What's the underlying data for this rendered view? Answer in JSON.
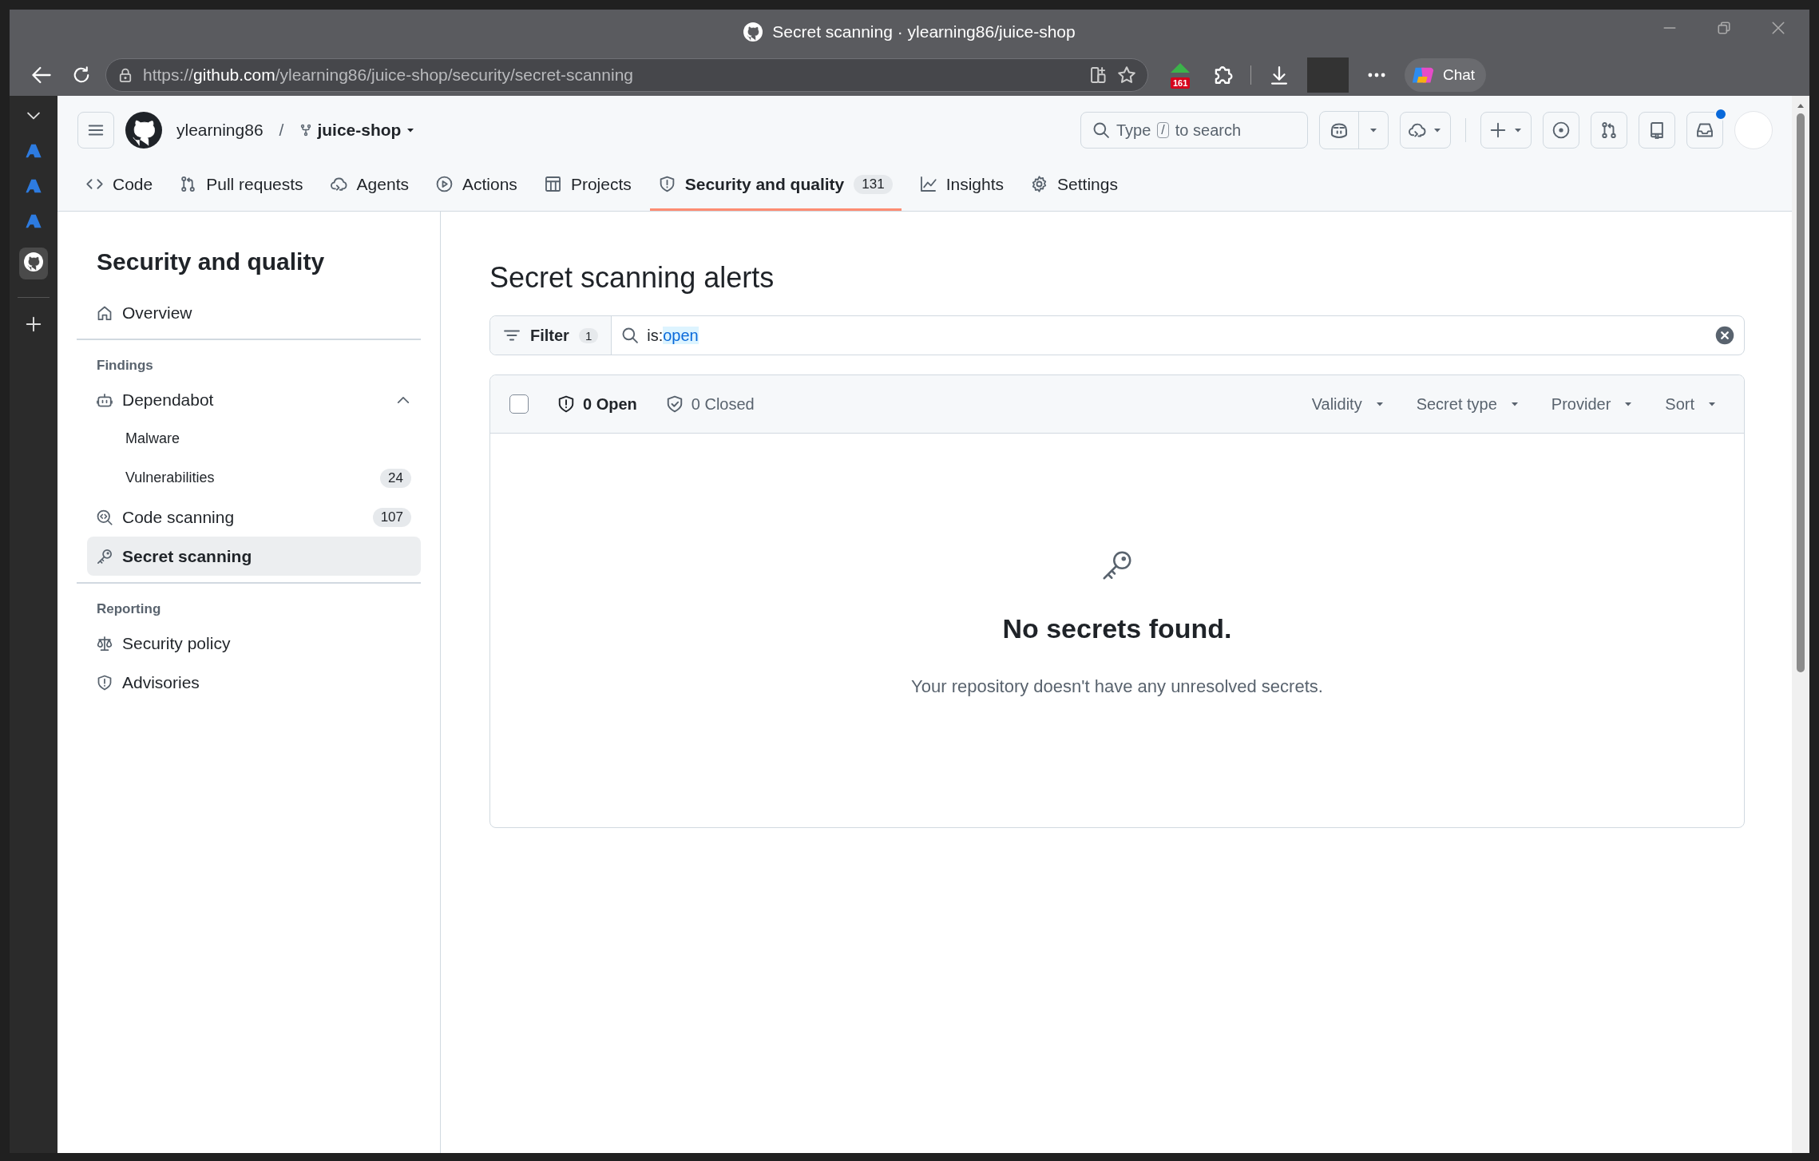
{
  "window": {
    "title": "Secret scanning · ylearning86/juice-shop"
  },
  "address_bar": {
    "scheme": "https://",
    "host": "github.com",
    "path": "/ylearning86/juice-shop/security/secret-scanning"
  },
  "toolbar": {
    "extension_badge": "161",
    "chat": "Chat"
  },
  "header": {
    "owner": "ylearning86",
    "separator": "/",
    "repo": "juice-shop",
    "search": {
      "prefix": "Type",
      "key": "/",
      "suffix": "to search"
    }
  },
  "tabs": [
    {
      "label": "Code",
      "selected": false
    },
    {
      "label": "Pull requests",
      "selected": false
    },
    {
      "label": "Agents",
      "selected": false
    },
    {
      "label": "Actions",
      "selected": false
    },
    {
      "label": "Projects",
      "selected": false
    },
    {
      "label": "Security and quality",
      "count": "131",
      "selected": true
    },
    {
      "label": "Insights",
      "selected": false
    },
    {
      "label": "Settings",
      "selected": false
    }
  ],
  "sidebar": {
    "title": "Security and quality",
    "sections": [
      {
        "items": [
          {
            "label": "Overview",
            "selected": false
          }
        ]
      },
      {
        "title": "Findings",
        "items": [
          {
            "label": "Dependabot",
            "selected": false,
            "expanded": true,
            "children": [
              {
                "label": "Malware",
                "selected": false
              },
              {
                "label": "Vulnerabilities",
                "count": "24",
                "selected": false
              }
            ]
          },
          {
            "label": "Code scanning",
            "count": "107",
            "selected": false
          },
          {
            "label": "Secret scanning",
            "selected": true
          }
        ]
      },
      {
        "title": "Reporting",
        "items": [
          {
            "label": "Security policy",
            "selected": false
          },
          {
            "label": "Advisories",
            "selected": false
          }
        ]
      }
    ]
  },
  "main": {
    "title": "Secret scanning alerts",
    "filter": {
      "label": "Filter",
      "count": "1",
      "query": {
        "qualifier": "is:",
        "value": "open"
      }
    },
    "list_header": {
      "checked": false,
      "states": [
        {
          "label": "0 Open",
          "selected": true
        },
        {
          "label": "0 Closed",
          "selected": false
        }
      ],
      "dropdowns": [
        "Validity",
        "Secret type",
        "Provider",
        "Sort"
      ]
    },
    "empty_state": {
      "title": "No secrets found.",
      "description": "Your repository doesn't have any unresolved secrets."
    }
  }
}
